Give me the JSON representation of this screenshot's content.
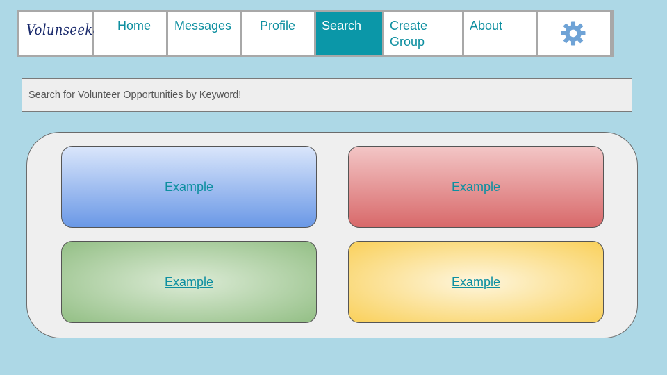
{
  "nav": {
    "logo": "Volunseeker",
    "items": [
      {
        "label": "Home"
      },
      {
        "label": "Messages"
      },
      {
        "label": "Profile"
      },
      {
        "label": "Search"
      },
      {
        "label": "Create Group"
      },
      {
        "label": "About"
      }
    ],
    "active_item": "Search",
    "settings_icon": "gear-icon"
  },
  "search": {
    "placeholder": "Search for Volunteer Opportunities by Keyword!",
    "value": ""
  },
  "results": {
    "cards": [
      {
        "label": "Example",
        "color": "blue"
      },
      {
        "label": "Example",
        "color": "red"
      },
      {
        "label": "Example",
        "color": "green"
      },
      {
        "label": "Example",
        "color": "yellow"
      }
    ]
  },
  "colors": {
    "background": "#add8e6",
    "accent": "#0b97a8",
    "link": "#0e8fa0"
  }
}
